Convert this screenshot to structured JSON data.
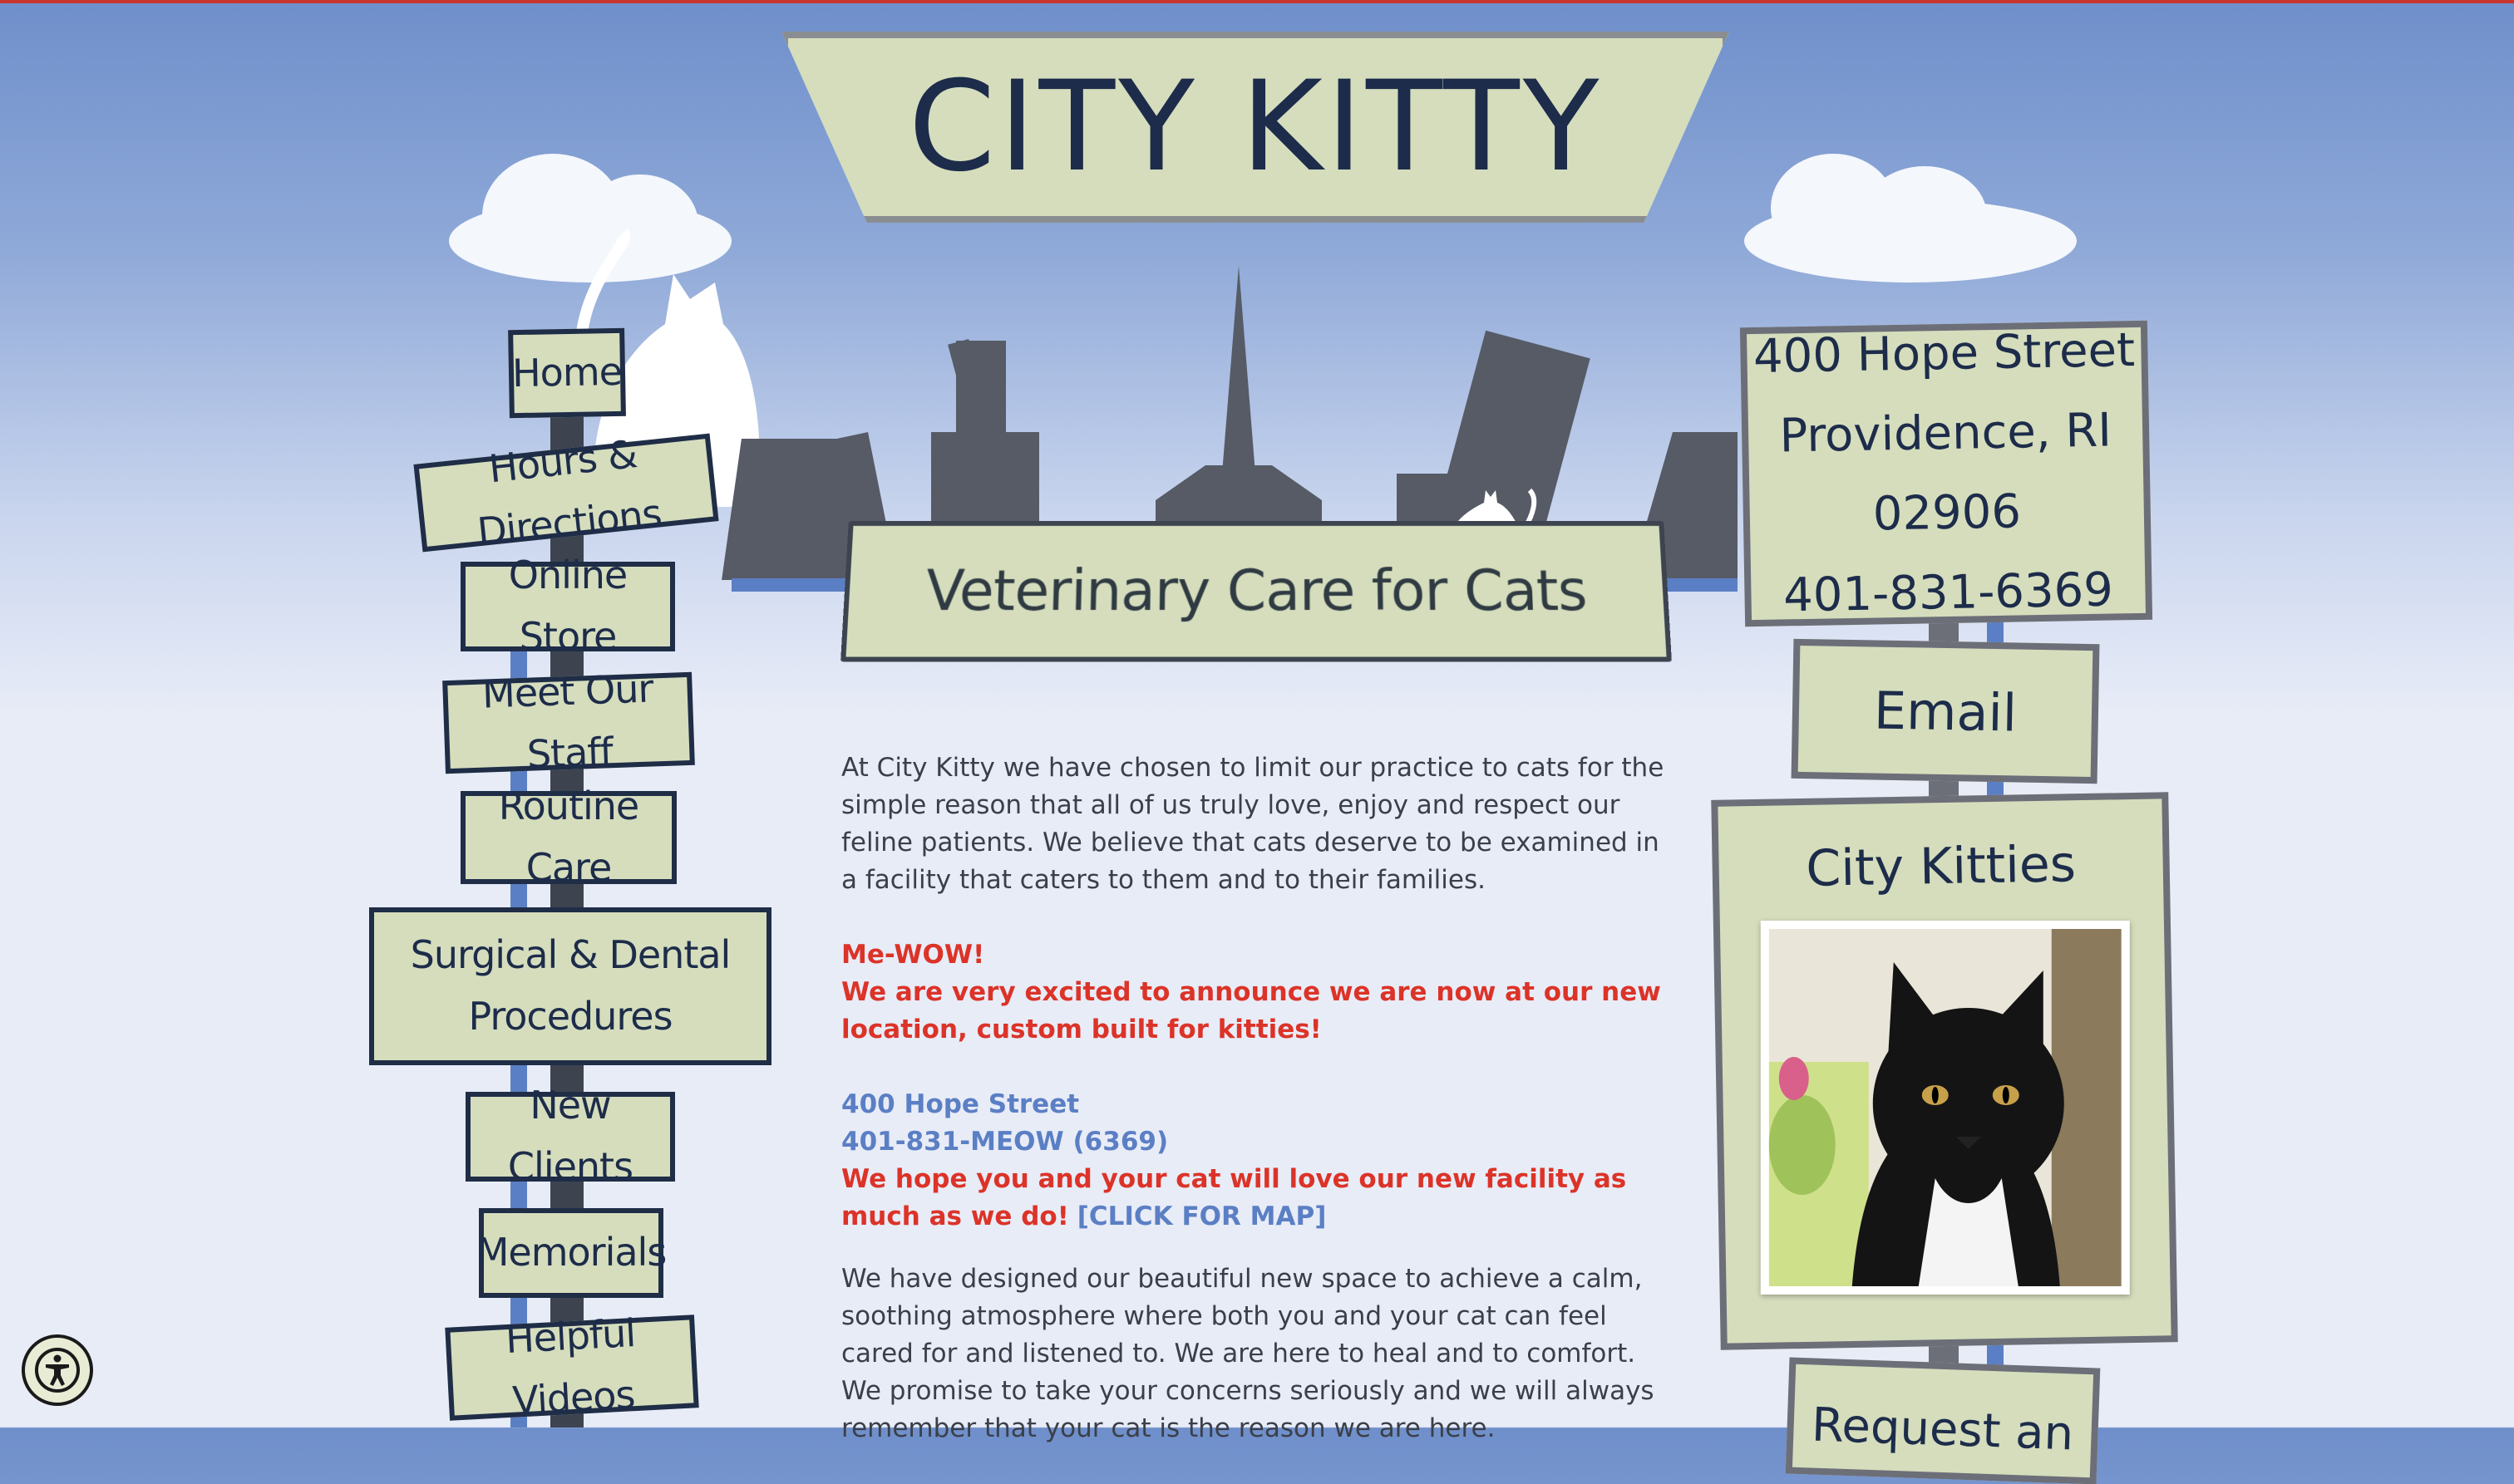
{
  "site": {
    "title": "City Kitty",
    "tagline": "Veterinary Care for Cats"
  },
  "nav": {
    "home": "Home",
    "hours": "Hours & Directions",
    "store": "Online Store",
    "staff": "Meet Our Staff",
    "routine": "Routine Care",
    "surgical_line1": "Surgical & Dental",
    "surgical_line2": "Procedures",
    "new_clients": "New Clients",
    "memorials": "Memorials",
    "videos": "Helpful Videos"
  },
  "sidebar": {
    "address_line1": "400 Hope Street",
    "address_line2": "Providence, RI 02906",
    "phone": "401-831-6369",
    "email_label": "Email",
    "kitties_label": "City Kitties",
    "request_label": "Request an"
  },
  "content": {
    "intro": "At City Kitty we have chosen to limit our practice to cats for the simple reason that all of us truly love, enjoy and respect our feline patients. We believe that cats deserve to be examined in a facility that caters to them and to their families.",
    "mewow": "Me-WOW!",
    "announce": "We are very excited to announce we are now at our new location, custom built for kitties!",
    "street": "400 Hope Street",
    "phone": "401-831-MEOW (6369)",
    "hope": "We hope you and your cat will love our new facility as much as we do!",
    "map_link": "[CLICK FOR MAP]",
    "designed": "We have designed our beautiful new space to achieve a calm, soothing atmosphere where both you and your cat can feel cared for and listened to. We are here to heal and to comfort. We promise to take your concerns seriously and we will always remember that your cat is the reason we are here."
  },
  "accessibility": {
    "icon": "accessibility-icon"
  },
  "colors": {
    "sign_fill": "#d5ddbd",
    "sign_border": "#1f2d47",
    "accent_red": "#dc3328",
    "accent_blue": "#5b7fc4"
  }
}
